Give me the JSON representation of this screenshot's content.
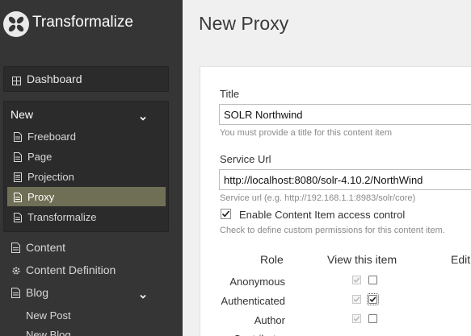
{
  "app": {
    "title": "Transformalize"
  },
  "sidebar": {
    "dashboard": "Dashboard",
    "new_group": {
      "label": "New",
      "items": [
        {
          "label": "Freeboard"
        },
        {
          "label": "Page"
        },
        {
          "label": "Projection"
        },
        {
          "label": "Proxy",
          "active": true
        },
        {
          "label": "Transformalize"
        }
      ]
    },
    "content": "Content",
    "content_definition": "Content Definition",
    "blog": "Blog",
    "new_post": "New Post",
    "new_blog": "New Blog"
  },
  "main": {
    "title": "New Proxy",
    "form": {
      "title_label": "Title",
      "title_value": "SOLR Northwind",
      "title_hint": "You must provide a title for this content item",
      "url_label": "Service Url",
      "url_value": "http://localhost:8080/solr-4.10.2/NorthWind",
      "url_hint": "Service url (e.g. http://192.168.1.1:8983/solr/core)",
      "access_label": "Enable Content Item access control",
      "access_checked": true,
      "access_hint": "Check to define custom permissions for this content item.",
      "permissions": {
        "headers": [
          "Role",
          "View this item",
          "Edit"
        ],
        "rows": [
          {
            "role": "Anonymous",
            "inherited": true,
            "view": false
          },
          {
            "role": "Authenticated",
            "inherited": true,
            "view": true
          },
          {
            "role": "Author",
            "inherited": true,
            "view": false
          },
          {
            "role": "Contributor",
            "inherited": true,
            "view": false
          }
        ]
      }
    }
  },
  "colors": {
    "sidebar_bg": "#353535",
    "active_item": "#6f6f56",
    "main_bg": "#f0f0f0"
  }
}
